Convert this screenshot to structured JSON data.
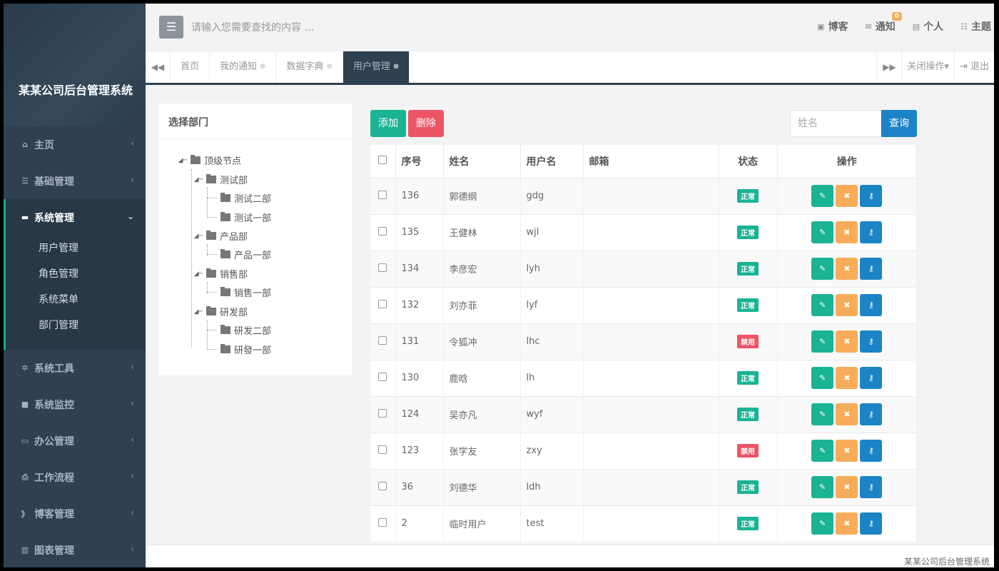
{
  "sidebar": {
    "brand": "某某公司后台管理系统",
    "items": [
      {
        "label": "主页",
        "icon": "home-icon",
        "glyph": "⌂"
      },
      {
        "label": "基础管理",
        "icon": "list-icon",
        "glyph": "☰"
      },
      {
        "label": "系统管理",
        "icon": "monitor-icon",
        "glyph": "▬"
      },
      {
        "label": "系统工具",
        "icon": "gear-icon",
        "glyph": "✲"
      },
      {
        "label": "系统监控",
        "icon": "video-icon",
        "glyph": "■"
      },
      {
        "label": "办公管理",
        "icon": "laptop-icon",
        "glyph": "▭"
      },
      {
        "label": "工作流程",
        "icon": "print-icon",
        "glyph": "⎙"
      },
      {
        "label": "博客管理",
        "icon": "rss-icon",
        "glyph": "》"
      },
      {
        "label": "图表管理",
        "icon": "bar-chart-icon",
        "glyph": "▥"
      }
    ],
    "sub_items": [
      "用户管理",
      "角色管理",
      "系统菜单",
      "部门管理"
    ]
  },
  "header": {
    "menu_glyph": "☰",
    "search_placeholder": "请输入您需要查找的内容 …",
    "links": [
      {
        "label": "博客",
        "icon": "rss-icon",
        "glyph": "▣"
      },
      {
        "label": "通知",
        "icon": "envelope-icon",
        "glyph": "✉",
        "badge": "0"
      },
      {
        "label": "个人",
        "icon": "id-card-icon",
        "glyph": "▤"
      },
      {
        "label": "主题",
        "icon": "theme-icon",
        "glyph": "☷"
      }
    ]
  },
  "tabs": {
    "prev_glyph": "◀◀",
    "next_glyph": "▶▶",
    "close_glyph": "⊗",
    "items": [
      "首页",
      "我的通知",
      "数据字典",
      "用户管理"
    ],
    "close_ops": "关闭操作▾",
    "logout": "退出"
  },
  "tree": {
    "title": "选择部门",
    "root": "顶级节点",
    "nodes": [
      "测试部",
      "测试二部",
      "测试一部",
      "产品部",
      "产品一部",
      "销售部",
      "销售一部",
      "研发部",
      "研发二部",
      "研發一部"
    ]
  },
  "toolbar": {
    "add": "添加",
    "delete": "删除",
    "name_placeholder": "姓名",
    "query": "查询"
  },
  "table": {
    "headers": [
      "序号",
      "姓名",
      "用户名",
      "邮箱",
      "状态",
      "操作"
    ],
    "rows": [
      {
        "id": "136",
        "name": "郭德纲",
        "username": "gdg",
        "email": "",
        "status": "正常"
      },
      {
        "id": "135",
        "name": "王健林",
        "username": "wjl",
        "email": "",
        "status": "正常"
      },
      {
        "id": "134",
        "name": "李彦宏",
        "username": "lyh",
        "email": "",
        "status": "正常"
      },
      {
        "id": "132",
        "name": "刘亦菲",
        "username": "lyf",
        "email": "",
        "status": "正常"
      },
      {
        "id": "131",
        "name": "令狐冲",
        "username": "lhc",
        "email": "",
        "status": "禁用"
      },
      {
        "id": "130",
        "name": "鹿晗",
        "username": "lh",
        "email": "",
        "status": "正常"
      },
      {
        "id": "124",
        "name": "吴亦凡",
        "username": "wyf",
        "email": "",
        "status": "正常"
      },
      {
        "id": "123",
        "name": "张学友",
        "username": "zxy",
        "email": "",
        "status": "禁用"
      },
      {
        "id": "36",
        "name": "刘德华",
        "username": "ldh",
        "email": "",
        "status": "正常"
      },
      {
        "id": "2",
        "name": "临时用户",
        "username": "test",
        "email": "",
        "status": "正常"
      }
    ],
    "op_glyphs": {
      "edit": "✎",
      "remove": "✖",
      "key": "⚷"
    }
  },
  "footer": {
    "text": "某某公司后台管理系统"
  },
  "colors": {
    "sidebar": "#2f4050",
    "accent": "#1ab394",
    "danger": "#ed5565",
    "warning": "#f8ac59",
    "primary": "#1c84c6"
  }
}
